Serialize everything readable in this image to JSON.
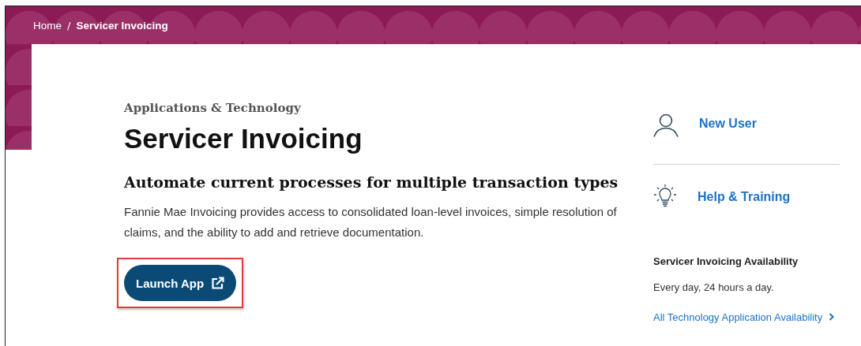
{
  "breadcrumb": [
    {
      "label": "Home",
      "current": false
    },
    {
      "label": "Servicer Invoicing",
      "current": true
    }
  ],
  "breadcrumb_separator": "/",
  "category": "Applications & Technology",
  "title": "Servicer Invoicing",
  "subtitle": "Automate current processes for multiple transaction types",
  "description": "Fannie Mae Invoicing provides access to consolidated loan-level invoices, simple resolution of claims, and the ability to add and retrieve documentation.",
  "launch_button": {
    "label": "Launch App",
    "highlighted": true
  },
  "quick_links": [
    {
      "kind": "user",
      "label": "New User"
    },
    {
      "kind": "help",
      "label": "Help & Training"
    }
  ],
  "availability": {
    "heading": "Servicer Invoicing Availability",
    "text": "Every day, 24 hours a day.",
    "link": "All Technology Application Availability"
  }
}
